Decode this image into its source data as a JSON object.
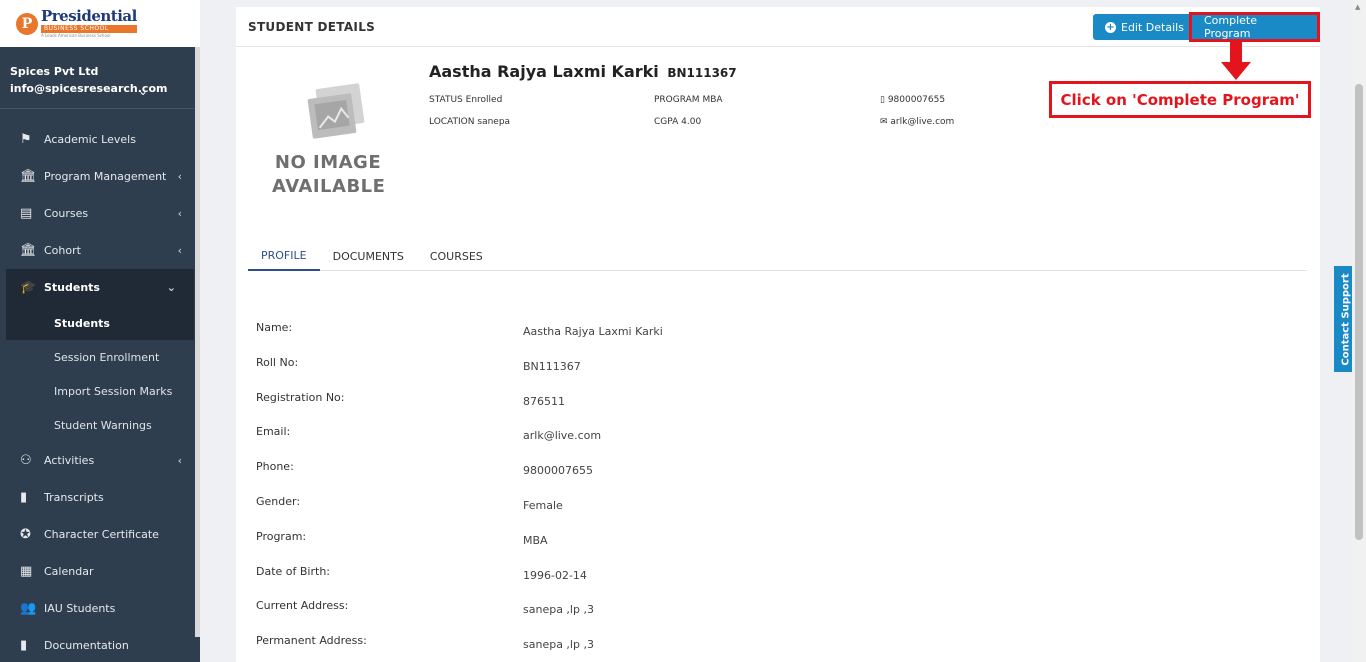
{
  "logo": {
    "initial": "P",
    "main": "Presidential",
    "sub": "BUSINESS SCHOOL",
    "tag": "A Leads American Business School"
  },
  "org": {
    "name": "Spices Pvt Ltd",
    "email": "info@spicesresearch.com"
  },
  "nav": [
    {
      "label": "Academic Levels",
      "icon": "flag-icon",
      "glyph": "⚑",
      "chevron": ""
    },
    {
      "label": "Program Management",
      "icon": "institution-icon",
      "glyph": "🏛",
      "chevron": "‹"
    },
    {
      "label": "Courses",
      "icon": "book-icon",
      "glyph": "▤",
      "chevron": "‹"
    },
    {
      "label": "Cohort",
      "icon": "institution-icon",
      "glyph": "🏛",
      "chevron": "‹"
    },
    {
      "label": "Students",
      "icon": "graduation-cap-icon",
      "glyph": "🎓",
      "chevron": "⌄"
    }
  ],
  "student_sub": [
    {
      "label": "Students"
    },
    {
      "label": "Session Enrollment"
    },
    {
      "label": "Import Session Marks"
    },
    {
      "label": "Student Warnings"
    }
  ],
  "nav_lower": [
    {
      "label": "Activities",
      "icon": "user-award-icon",
      "glyph": "⚇",
      "chevron": "‹"
    },
    {
      "label": "Transcripts",
      "icon": "file-icon",
      "glyph": "▮",
      "chevron": ""
    },
    {
      "label": "Character Certificate",
      "icon": "award-icon",
      "glyph": "✪",
      "chevron": ""
    },
    {
      "label": "Calendar",
      "icon": "calendar-check-icon",
      "glyph": "▦",
      "chevron": ""
    },
    {
      "label": "IAU Students",
      "icon": "users-icon",
      "glyph": "👥",
      "chevron": ""
    },
    {
      "label": "Documentation",
      "icon": "file-icon",
      "glyph": "▮",
      "chevron": ""
    }
  ],
  "card": {
    "title": "STUDENT DETAILS",
    "edit_label": "Edit Details",
    "complete_label": "Complete Program"
  },
  "annotation": {
    "text": "Click on 'Complete Program'"
  },
  "no_image": {
    "line1": "NO IMAGE",
    "line2": "AVAILABLE"
  },
  "student": {
    "name": "Aastha Rajya Laxmi Karki",
    "roll": "BN111367",
    "status_key": "STATUS",
    "status": "Enrolled",
    "location_key": "LOCATION",
    "location": "sanepa",
    "program_key": "PROGRAM",
    "program": "MBA",
    "cgpa_key": "CGPA",
    "cgpa": "4.00",
    "phone": "9800007655",
    "email": "arlk@live.com"
  },
  "tabs": [
    {
      "label": "PROFILE"
    },
    {
      "label": "DOCUMENTS"
    },
    {
      "label": "COURSES"
    }
  ],
  "profile": [
    {
      "label": "Name:",
      "value": "Aastha Rajya Laxmi Karki"
    },
    {
      "label": "Roll No:",
      "value": "BN111367"
    },
    {
      "label": "Registration No:",
      "value": "876511"
    },
    {
      "label": "Email:",
      "value": "arlk@live.com"
    },
    {
      "label": "Phone:",
      "value": "9800007655"
    },
    {
      "label": "Gender:",
      "value": "Female"
    },
    {
      "label": "Program:",
      "value": "MBA"
    },
    {
      "label": "Date of Birth:",
      "value": "1996-02-14"
    },
    {
      "label": "Current Address:",
      "value": "sanepa ,lp ,3"
    },
    {
      "label": "Permanent Address:",
      "value": "sanepa ,lp ,3"
    }
  ],
  "contact": {
    "label": "Contact Support"
  },
  "colors": {
    "sidebar": "#2f3e4e",
    "accent": "#1a8ac6",
    "annotation": "#e3141c"
  }
}
